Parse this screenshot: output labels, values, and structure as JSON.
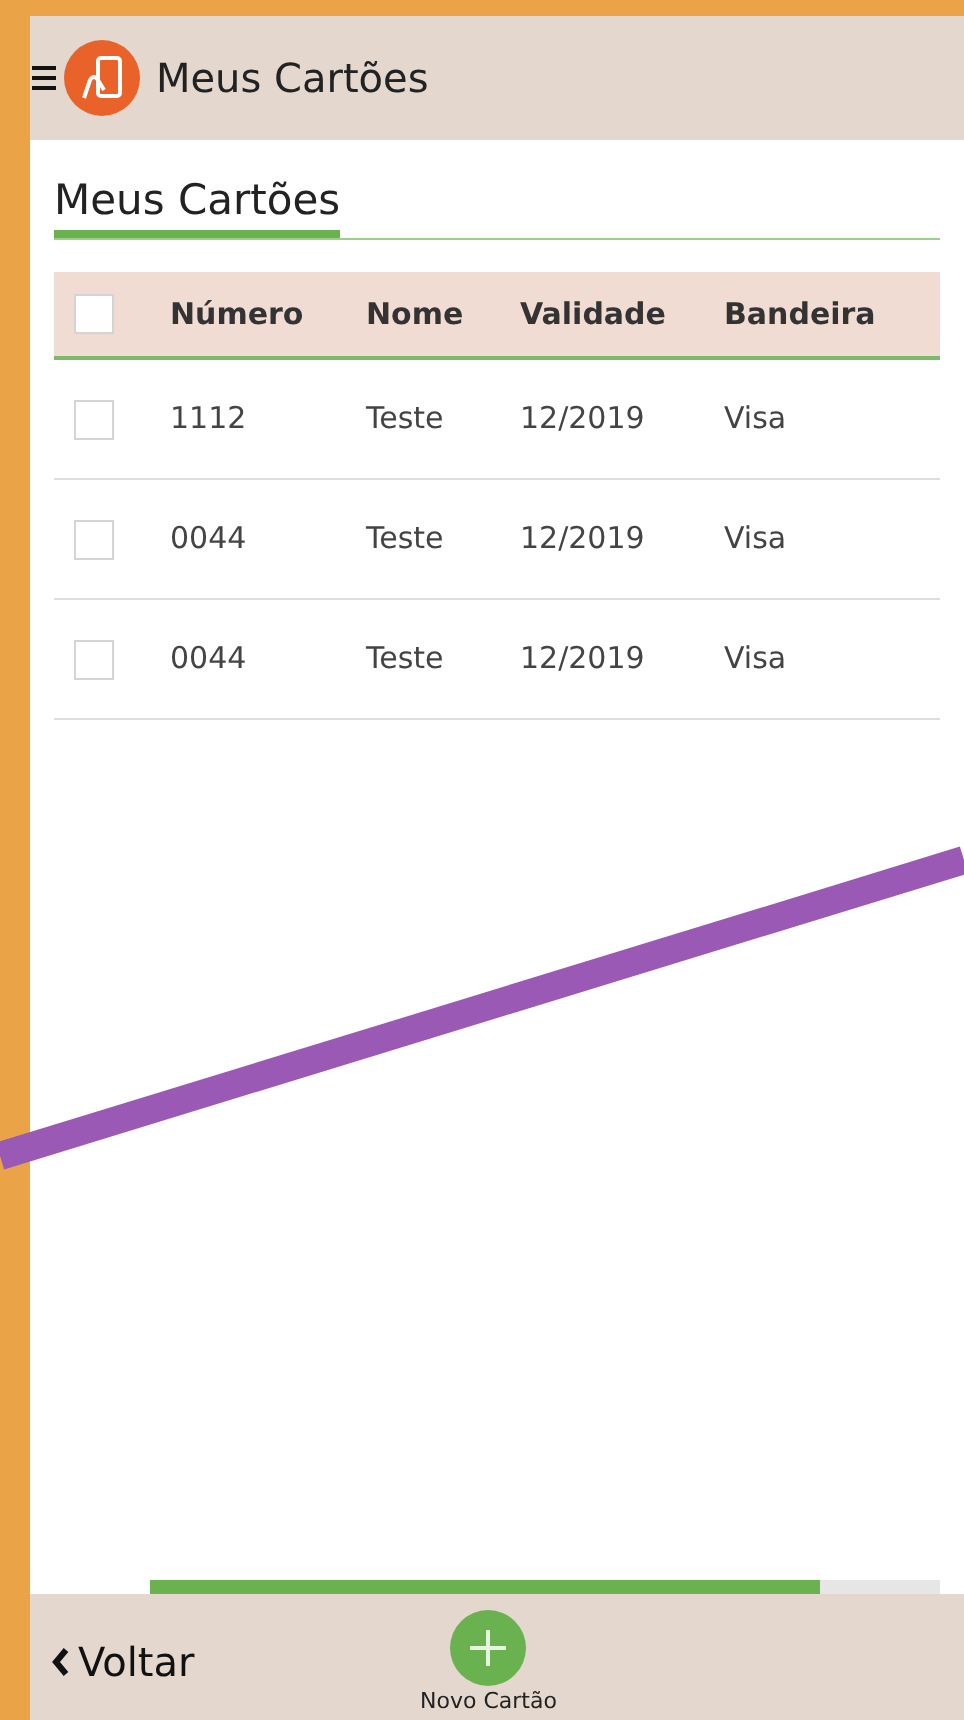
{
  "header": {
    "title": "Meus Cartões"
  },
  "page_title": "Meus Cartões",
  "table": {
    "columns": [
      "Número",
      "Nome",
      "Validade",
      "Bandeira"
    ],
    "select_all": {
      "checked": false
    },
    "rows": [
      {
        "checked": false,
        "cells": [
          "1112",
          "Teste",
          "12/2019",
          "Visa"
        ]
      },
      {
        "checked": false,
        "cells": [
          "0044",
          "Teste",
          "12/2019",
          "Visa"
        ]
      },
      {
        "checked": false,
        "cells": [
          "0044",
          "Teste",
          "12/2019",
          "Visa"
        ]
      }
    ]
  },
  "footer": {
    "back": "Voltar",
    "new_card": "Novo Cartão"
  }
}
